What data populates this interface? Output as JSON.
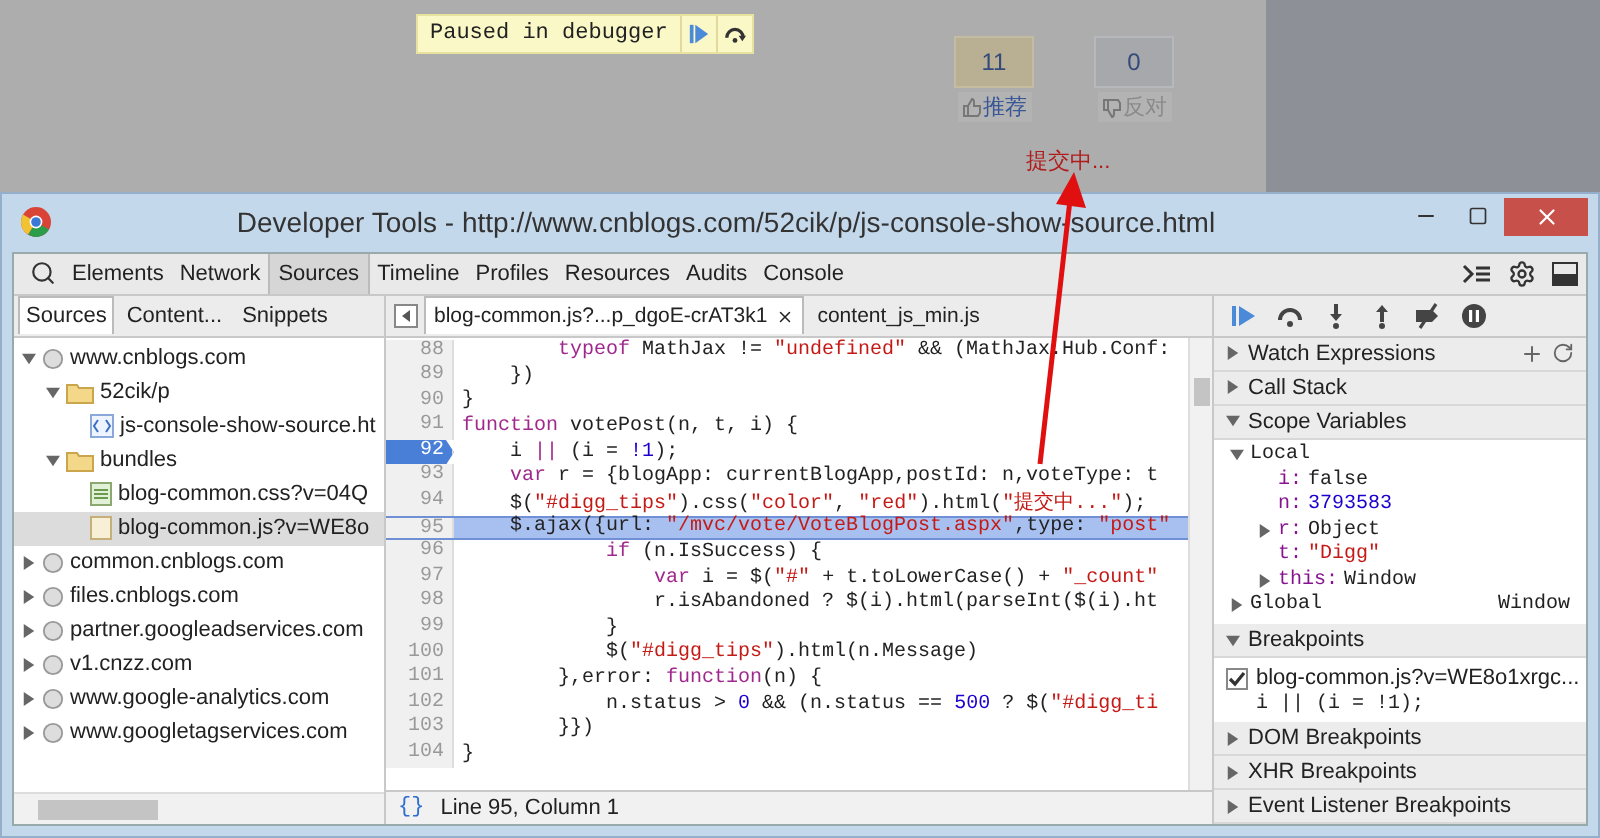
{
  "page": {
    "debugger_banner": "Paused in debugger",
    "votes": [
      {
        "count": "11",
        "label": "推荐",
        "selected": true
      },
      {
        "count": "0",
        "label": "反对",
        "selected": false
      }
    ],
    "vote_tips": "提交中..."
  },
  "window": {
    "title": "Developer Tools - http://www.cnblogs.com/52cik/p/js-console-show-source.html"
  },
  "tabs": [
    {
      "label": "Elements",
      "selected": false
    },
    {
      "label": "Network",
      "selected": false
    },
    {
      "label": "Sources",
      "selected": true
    },
    {
      "label": "Timeline",
      "selected": false
    },
    {
      "label": "Profiles",
      "selected": false
    },
    {
      "label": "Resources",
      "selected": false
    },
    {
      "label": "Audits",
      "selected": false
    },
    {
      "label": "Console",
      "selected": false
    }
  ],
  "sidebar": {
    "tabs": [
      {
        "label": "Sources",
        "selected": true
      },
      {
        "label": "Content...",
        "selected": false
      },
      {
        "label": "Snippets",
        "selected": false
      }
    ],
    "tree": [
      {
        "label": "www.cnblogs.com",
        "kind": "domain",
        "expanded": true,
        "selected": false,
        "children": [
          {
            "label": "52cik/p",
            "kind": "folder",
            "expanded": true,
            "selected": false,
            "children": [
              {
                "label": "js-console-show-source.ht",
                "kind": "html",
                "selected": false
              }
            ]
          },
          {
            "label": "bundles",
            "kind": "folder",
            "expanded": true,
            "selected": false,
            "children": [
              {
                "label": "blog-common.css?v=04Q",
                "kind": "css",
                "selected": false
              },
              {
                "label": "blog-common.js?v=WE8o",
                "kind": "js",
                "selected": true
              }
            ]
          }
        ]
      },
      {
        "label": "common.cnblogs.com",
        "kind": "domain",
        "expanded": false,
        "selected": false
      },
      {
        "label": "files.cnblogs.com",
        "kind": "domain",
        "expanded": false,
        "selected": false
      },
      {
        "label": "partner.googleadservices.com",
        "kind": "domain",
        "expanded": false,
        "selected": false
      },
      {
        "label": "v1.cnzz.com",
        "kind": "domain",
        "expanded": false,
        "selected": false
      },
      {
        "label": "www.google-analytics.com",
        "kind": "domain",
        "expanded": false,
        "selected": false
      },
      {
        "label": "www.googletagservices.com",
        "kind": "domain",
        "expanded": false,
        "selected": false
      }
    ]
  },
  "editor": {
    "tabs": [
      {
        "label": "blog-common.js?...p_dgoE-crAT3k1",
        "selected": true,
        "closable": true
      },
      {
        "label": "content_js_min.js",
        "selected": false,
        "closable": false
      }
    ],
    "lines": [
      {
        "number": "88",
        "breakpoint": false,
        "current": false,
        "tokens": [
          {
            "kind": "keyword",
            "text": "        typeof"
          },
          {
            "kind": "plain",
            "text": " MathJax != "
          },
          {
            "kind": "string",
            "text": "\"undefined\""
          },
          {
            "kind": "plain",
            "text": " && (MathJax.Hub.Conf:"
          }
        ]
      },
      {
        "number": "89",
        "breakpoint": false,
        "current": false,
        "tokens": [
          {
            "kind": "plain",
            "text": "    })"
          }
        ]
      },
      {
        "number": "90",
        "breakpoint": false,
        "current": false,
        "tokens": [
          {
            "kind": "plain",
            "text": "}"
          }
        ]
      },
      {
        "number": "91",
        "breakpoint": false,
        "current": false,
        "tokens": [
          {
            "kind": "keyword",
            "text": "function"
          },
          {
            "kind": "plain",
            "text": " votePost(n, t, i) {"
          }
        ]
      },
      {
        "number": "92",
        "breakpoint": true,
        "current": false,
        "tokens": [
          {
            "kind": "plain",
            "text": "    i "
          },
          {
            "kind": "keyword",
            "text": "||"
          },
          {
            "kind": "plain",
            "text": " (i = "
          },
          {
            "kind": "number",
            "text": "!1"
          },
          {
            "kind": "plain",
            "text": ");"
          }
        ]
      },
      {
        "number": "93",
        "breakpoint": false,
        "current": false,
        "tokens": [
          {
            "kind": "keyword",
            "text": "    var"
          },
          {
            "kind": "plain",
            "text": " r = {blogApp: currentBlogApp,postId: n,voteType: t"
          }
        ]
      },
      {
        "number": "94",
        "breakpoint": false,
        "current": false,
        "tokens": [
          {
            "kind": "plain",
            "text": "    $("
          },
          {
            "kind": "string",
            "text": "\"#digg_tips\""
          },
          {
            "kind": "plain",
            "text": ").css("
          },
          {
            "kind": "string",
            "text": "\"color\""
          },
          {
            "kind": "plain",
            "text": ", "
          },
          {
            "kind": "string",
            "text": "\"red\""
          },
          {
            "kind": "plain",
            "text": ").html("
          },
          {
            "kind": "string",
            "text": "\"提交中...\""
          },
          {
            "kind": "plain",
            "text": ");"
          }
        ]
      },
      {
        "number": "95",
        "breakpoint": false,
        "current": true,
        "tokens": [
          {
            "kind": "plain",
            "text": "    $.ajax({url: "
          },
          {
            "kind": "string",
            "text": "\"/mvc/vote/VoteBlogPost.aspx\""
          },
          {
            "kind": "plain",
            "text": ",type: "
          },
          {
            "kind": "string",
            "text": "\"post\""
          }
        ]
      },
      {
        "number": "96",
        "breakpoint": false,
        "current": false,
        "tokens": [
          {
            "kind": "keyword",
            "text": "            if"
          },
          {
            "kind": "plain",
            "text": " (n.IsSuccess) {"
          }
        ]
      },
      {
        "number": "97",
        "breakpoint": false,
        "current": false,
        "tokens": [
          {
            "kind": "keyword",
            "text": "                var"
          },
          {
            "kind": "plain",
            "text": " i = $("
          },
          {
            "kind": "string",
            "text": "\"#\""
          },
          {
            "kind": "plain",
            "text": " + t.toLowerCase() + "
          },
          {
            "kind": "string",
            "text": "\"_count\""
          }
        ]
      },
      {
        "number": "98",
        "breakpoint": false,
        "current": false,
        "tokens": [
          {
            "kind": "plain",
            "text": "                r.isAbandoned ? $(i).html(parseInt($(i).ht"
          }
        ]
      },
      {
        "number": "99",
        "breakpoint": false,
        "current": false,
        "tokens": [
          {
            "kind": "plain",
            "text": "            }"
          }
        ]
      },
      {
        "number": "100",
        "breakpoint": false,
        "current": false,
        "tokens": [
          {
            "kind": "plain",
            "text": "            $("
          },
          {
            "kind": "string",
            "text": "\"#digg_tips\""
          },
          {
            "kind": "plain",
            "text": ").html(n.Message)"
          }
        ]
      },
      {
        "number": "101",
        "breakpoint": false,
        "current": false,
        "tokens": [
          {
            "kind": "plain",
            "text": "        },error: "
          },
          {
            "kind": "keyword",
            "text": "function"
          },
          {
            "kind": "plain",
            "text": "(n) {"
          }
        ]
      },
      {
        "number": "102",
        "breakpoint": false,
        "current": false,
        "tokens": [
          {
            "kind": "plain",
            "text": "            n.status > "
          },
          {
            "kind": "number",
            "text": "0"
          },
          {
            "kind": "plain",
            "text": " && (n.status == "
          },
          {
            "kind": "number",
            "text": "500"
          },
          {
            "kind": "plain",
            "text": " ? $("
          },
          {
            "kind": "string",
            "text": "\"#digg_ti"
          }
        ]
      },
      {
        "number": "103",
        "breakpoint": false,
        "current": false,
        "tokens": [
          {
            "kind": "plain",
            "text": "        }})"
          }
        ]
      },
      {
        "number": "104",
        "breakpoint": false,
        "current": false,
        "tokens": [
          {
            "kind": "plain",
            "text": "}"
          }
        ]
      }
    ],
    "status": {
      "format_button": "{}",
      "position": "Line 95, Column 1"
    }
  },
  "debugger": {
    "sections": [
      {
        "title": "Watch Expressions",
        "expanded": false,
        "kind": "watch"
      },
      {
        "title": "Call Stack",
        "expanded": false,
        "kind": "plain"
      },
      {
        "title": "Scope Variables",
        "expanded": true,
        "kind": "scope",
        "scopes": [
          {
            "name": "Local",
            "expanded": true,
            "vars": [
              {
                "name": "i:",
                "value": "false",
                "kind": "bool",
                "expandable": false
              },
              {
                "name": "n:",
                "value": "3793583",
                "kind": "num",
                "expandable": false
              },
              {
                "name": "r:",
                "value": "Object",
                "kind": "obj",
                "expandable": true
              },
              {
                "name": "t:",
                "value": "\"Digg\"",
                "kind": "str",
                "expandable": false
              },
              {
                "name": "this:",
                "value": "Window",
                "kind": "obj",
                "expandable": true
              }
            ]
          },
          {
            "name": "Global",
            "value": "Window",
            "expanded": false
          }
        ]
      },
      {
        "title": "Breakpoints",
        "expanded": true,
        "kind": "breakpoints",
        "items": [
          {
            "file": "blog-common.js?v=WE8o1xrgc...",
            "code": "i || (i = !1);",
            "checked": true
          }
        ]
      },
      {
        "title": "DOM Breakpoints",
        "expanded": false,
        "kind": "plain"
      },
      {
        "title": "XHR Breakpoints",
        "expanded": false,
        "kind": "plain"
      },
      {
        "title": "Event Listener Breakpoints",
        "expanded": false,
        "kind": "plain"
      }
    ]
  }
}
